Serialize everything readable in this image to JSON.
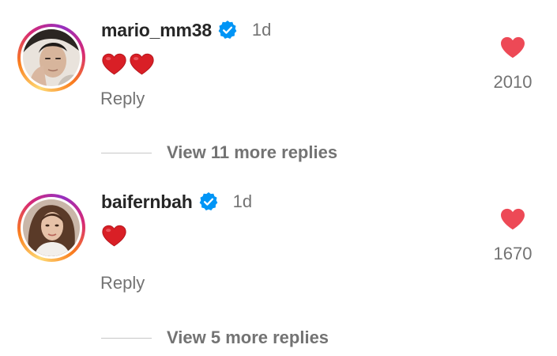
{
  "comments": [
    {
      "username": "mario_mm38",
      "verified": true,
      "time": "1d",
      "emoji_count": 2,
      "emoji_icon": "red-heart-emoji",
      "reply_label": "Reply",
      "like_count": "2010",
      "view_more_label": "View 11 more replies"
    },
    {
      "username": "baifernbah",
      "verified": true,
      "time": "1d",
      "emoji_count": 1,
      "emoji_icon": "red-heart-emoji",
      "reply_label": "Reply",
      "like_count": "1670",
      "view_more_label": "View 5 more replies"
    }
  ],
  "colors": {
    "heart": "#ed4956",
    "verified": "#0095f6",
    "secondary_text": "#737373",
    "primary_text": "#262626"
  }
}
